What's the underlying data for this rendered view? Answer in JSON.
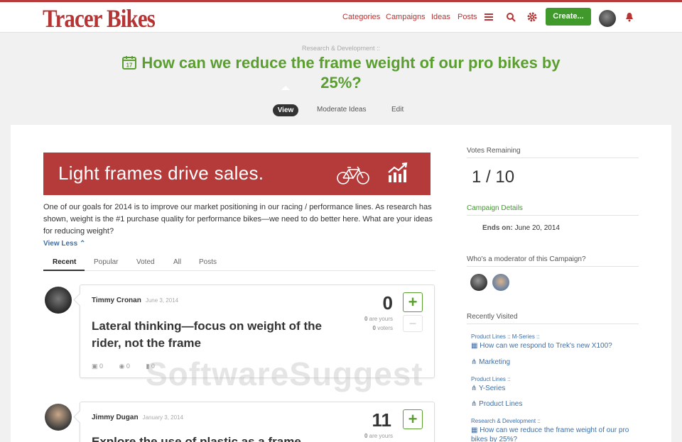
{
  "brand": {
    "logo_text": "Tracer Bikes",
    "accent": "#b63434",
    "green": "#3f9a2b"
  },
  "nav": {
    "links": [
      "Categories",
      "Campaigns",
      "Ideas",
      "Posts"
    ],
    "create_label": "Create...",
    "icons": [
      "menu-icon",
      "search-icon",
      "gear-icon",
      "bell-icon"
    ]
  },
  "campaign": {
    "breadcrumb": "Research & Development ::",
    "title": "How can we reduce the frame weight of our pro bikes by 25%?",
    "calendar_day": "17",
    "tabs": [
      "View",
      "Moderate Ideas",
      "Edit"
    ]
  },
  "banner": {
    "text": "Light frames drive sales."
  },
  "description": {
    "text": "One of our goals for 2014 is to improve our market positioning in our racing / performance lines. As research has shown, weight is the #1 purchase quality for performance bikes—we need to do better here. What are your ideas for reducing weight?",
    "view_less": "View Less"
  },
  "filters": [
    "Recent",
    "Popular",
    "Voted",
    "All",
    "Posts"
  ],
  "ideas": [
    {
      "author": "Timmy Cronan",
      "date": "June 3, 2014",
      "title": "Lateral thinking—focus on weight of the rider, not the frame",
      "votes": "0",
      "yours": "0",
      "yours_label": "are yours",
      "voters": "0",
      "voters_label": "voters",
      "stat_posts": "0",
      "stat_views": "0",
      "stat_comments": "0"
    },
    {
      "author": "Jimmy Dugan",
      "date": "January 3, 2014",
      "title": "Explore the use of plastic as a frame",
      "votes": "11",
      "yours": "0",
      "yours_label": "are yours"
    }
  ],
  "sidebar": {
    "votes_remaining_label": "Votes Remaining",
    "votes_remaining": "1 / 10",
    "campaign_details_label": "Campaign Details",
    "ends_on_label": "Ends on:",
    "ends_on": "June 20, 2014",
    "moderator_label": "Who's a moderator of this Campaign?",
    "recently_visited_label": "Recently Visited",
    "recent": [
      {
        "crumb": "Product Lines :: M-Series ::",
        "title": "How can we respond to Trek's new X100?"
      },
      {
        "crumb": "",
        "title": "Marketing"
      },
      {
        "crumb": "Product Lines ::",
        "title": "Y-Series"
      },
      {
        "crumb": "",
        "title": "Product Lines"
      },
      {
        "crumb": "Research & Development ::",
        "title": "How can we reduce the frame weight of our pro bikes by 25%?"
      }
    ]
  },
  "watermark": "SoftwareSuggest"
}
